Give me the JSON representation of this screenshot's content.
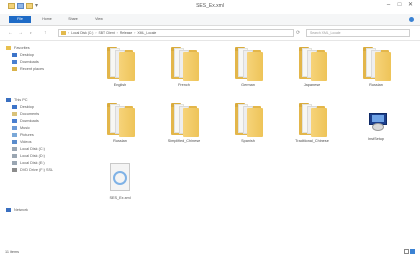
{
  "window": {
    "title": "SES_Ex.xml"
  },
  "controls": {
    "minimize": "–",
    "maximize": "□",
    "close": "✕"
  },
  "ribbon": {
    "tabs": [
      "File",
      "Home",
      "Share",
      "View"
    ]
  },
  "addressbar": {
    "back": "←",
    "forward": "→",
    "up": "↑",
    "path": [
      "Local Disk (C:)",
      "SBT Client",
      "Release",
      "XML_Locale"
    ],
    "refresh": "⟳",
    "search_placeholder": "Search XML_Locale"
  },
  "navpane": {
    "favorites": {
      "label": "Favorites",
      "items": [
        "Desktop",
        "Downloads",
        "Recent places"
      ]
    },
    "thispc": {
      "label": "This PC",
      "items": [
        "Desktop",
        "Documents",
        "Downloads",
        "Music",
        "Pictures",
        "Videos",
        "Local Disk (C:)",
        "Local Disk (D:)",
        "Local Disk (E:)",
        "DVD Drive (F:) SSL"
      ]
    },
    "network": {
      "label": "Network"
    }
  },
  "items": [
    {
      "name": "English",
      "type": "folder"
    },
    {
      "name": "French",
      "type": "folder"
    },
    {
      "name": "German",
      "type": "folder"
    },
    {
      "name": "Japanese",
      "type": "folder"
    },
    {
      "name": "Russian",
      "type": "folder"
    },
    {
      "name": "Russian",
      "type": "folder"
    },
    {
      "name": "Simplified_Chinese",
      "type": "folder"
    },
    {
      "name": "Spanish",
      "type": "folder"
    },
    {
      "name": "Traditional_Chinese",
      "type": "folder"
    },
    {
      "name": "InstSetup",
      "type": "setup"
    },
    {
      "name": "SES_Ex.xml",
      "type": "xml"
    }
  ],
  "statusbar": {
    "text": "11 items"
  },
  "colors": {
    "folder": "#e3b64a",
    "accent": "#1f6bc6"
  }
}
